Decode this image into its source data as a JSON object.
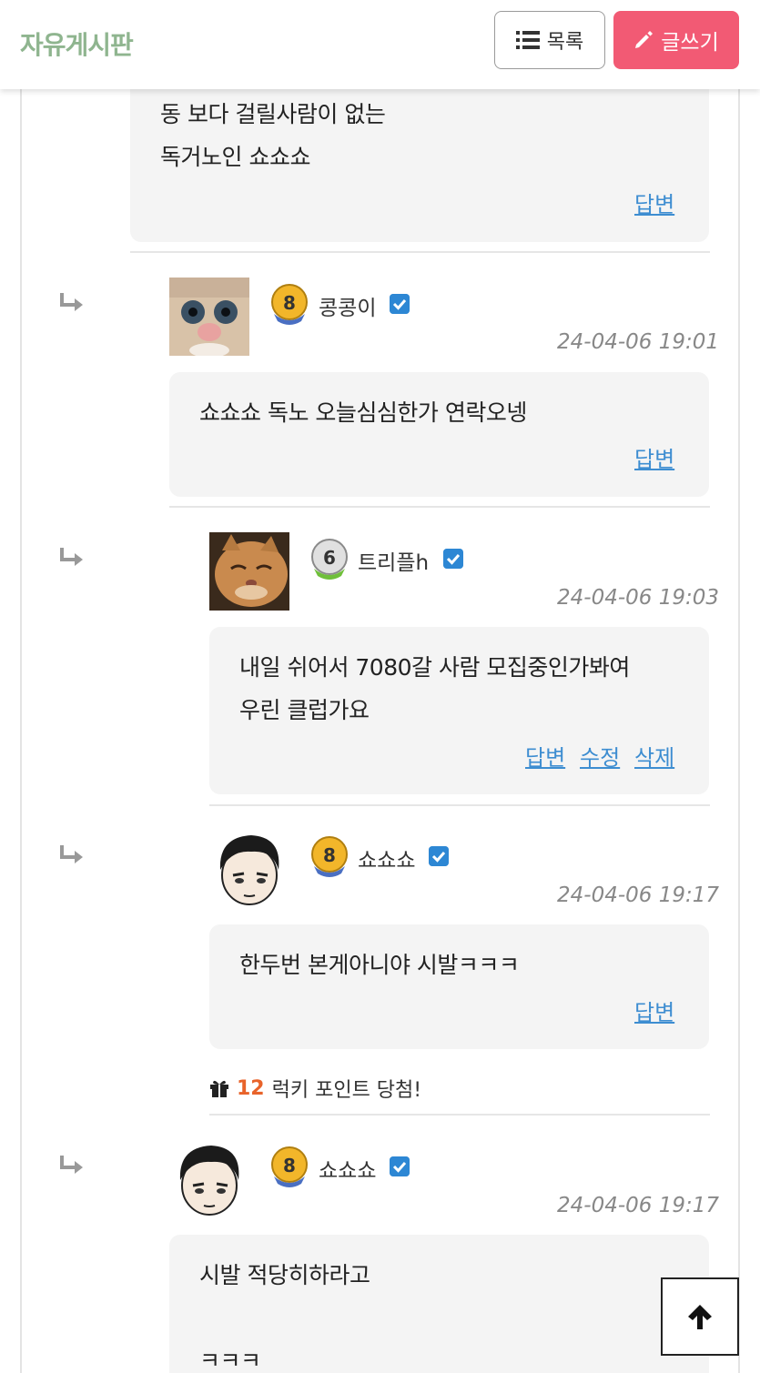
{
  "header": {
    "title": "자유게시판",
    "list_label": "목록",
    "write_label": "글쓰기"
  },
  "comments": [
    {
      "lines": [
        "동 보다 걸릴사람이 없는",
        "독거노인 쇼쇼쇼"
      ],
      "actions": [
        "답변"
      ]
    },
    {
      "username": "콩콩이",
      "level": "8",
      "date": "24-04-06 19:01",
      "lines": [
        "쇼쇼쇼 독노 오늘심심한가 연락오넹"
      ],
      "actions": [
        "답변"
      ]
    },
    {
      "username": "트리플h",
      "level": "6",
      "date": "24-04-06 19:03",
      "lines": [
        "내일 쉬어서 7080갈 사람 모집중인가봐여",
        "우린 클럽가요"
      ],
      "actions": [
        "답변",
        "수정",
        "삭제"
      ]
    },
    {
      "username": "쇼쇼쇼",
      "level": "8",
      "date": "24-04-06 19:17",
      "lines": [
        "한두번 본게아니야 시발ㅋㅋㅋ"
      ],
      "actions": [
        "답변"
      ]
    },
    {
      "username": "쇼쇼쇼",
      "level": "8",
      "date": "24-04-06 19:17",
      "lines": [
        "시발 적당히하라고",
        "",
        "ㅋㅋㅋ"
      ],
      "actions": []
    }
  ],
  "lucky": {
    "points": "12",
    "text": "럭키 포인트 당첨!"
  },
  "colors": {
    "accent_write": "#f25a74",
    "title_green": "#8fb58f",
    "link_blue": "#3d8dd1",
    "badge_blue": "#2d87d4"
  }
}
